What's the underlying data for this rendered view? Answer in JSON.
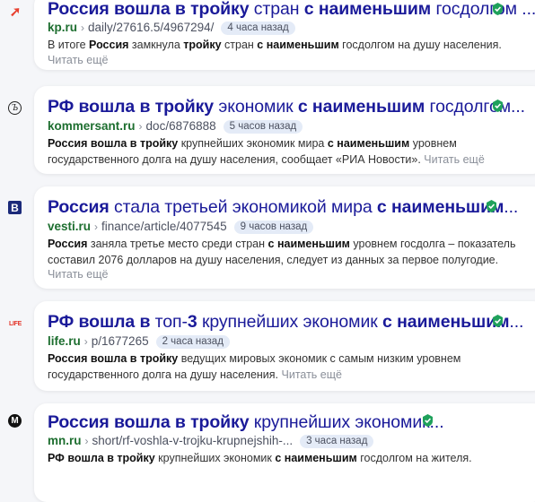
{
  "results": [
    {
      "favicon": "kp-icon",
      "title_parts": [
        [
          "Россия вошла в тройку",
          true
        ],
        [
          " стран ",
          false
        ],
        [
          "с наименьшим",
          true
        ],
        [
          " госдолгом ...",
          false
        ]
      ],
      "domain": "kp.ru",
      "path": "daily/27616.5/4967294/",
      "time": "4 часа назад",
      "snippet_lines": [
        [
          [
            "В итоге ",
            false
          ],
          [
            "Россия",
            true
          ],
          [
            " замкнула ",
            false
          ],
          [
            "тройку",
            true
          ],
          [
            " стран ",
            false
          ],
          [
            "с наименьшим",
            true
          ],
          [
            " госдолгом на душу населения.",
            false
          ]
        ]
      ],
      "more": "Читать ещё"
    },
    {
      "favicon": "kommersant-icon",
      "title_parts": [
        [
          "РФ вошла в тройку",
          true
        ],
        [
          " экономик ",
          false
        ],
        [
          "с наименьшим",
          true
        ],
        [
          " госдолгом...",
          false
        ]
      ],
      "domain": "kommersant.ru",
      "path": "doc/6876888",
      "time": "5 часов назад",
      "snippet_lines": [
        [
          [
            "Россия вошла в тройку",
            true
          ],
          [
            " крупнейших экономик мира ",
            false
          ],
          [
            "с наименьшим",
            true
          ],
          [
            " уровнем",
            false
          ]
        ],
        [
          [
            "государственного долга на душу населения, сообщает «РИА Новости».",
            false
          ]
        ]
      ],
      "more": "Читать ещё"
    },
    {
      "favicon": "vesti-icon",
      "title_parts": [
        [
          "Россия",
          true
        ],
        [
          " стала третьей экономикой мира ",
          false
        ],
        [
          "с наименьшим",
          true
        ],
        [
          "...",
          false
        ]
      ],
      "domain": "vesti.ru",
      "path": "finance/article/4077545",
      "time": "9 часов назад",
      "snippet_lines": [
        [
          [
            "Россия",
            true
          ],
          [
            " заняла третье место среди стран ",
            false
          ],
          [
            "с наименьшим",
            true
          ],
          [
            " уровнем госдолга – показатель",
            false
          ]
        ],
        [
          [
            "составил 2076 долларов на душу населения, следует из данных за первое полугодие.",
            false
          ]
        ]
      ],
      "more": "Читать ещё"
    },
    {
      "favicon": "life-icon",
      "title_parts": [
        [
          "РФ вошла в",
          true
        ],
        [
          " топ-",
          false
        ],
        [
          "3",
          true
        ],
        [
          " крупнейших экономик ",
          false
        ],
        [
          "с наименьшим",
          true
        ],
        [
          "...",
          false
        ]
      ],
      "domain": "life.ru",
      "path": "p/1677265",
      "time": "2 часа назад",
      "snippet_lines": [
        [
          [
            "Россия вошла в тройку",
            true
          ],
          [
            " ведущих мировых экономик с самым низким уровнем",
            false
          ]
        ],
        [
          [
            "государственного долга на душу населения.",
            false
          ]
        ]
      ],
      "more": "Читать ещё"
    },
    {
      "favicon": "mn-icon",
      "title_parts": [
        [
          "Россия вошла в тройку",
          true
        ],
        [
          " крупнейших экономик...",
          false
        ]
      ],
      "domain": "mn.ru",
      "path": "short/rf-voshla-v-trojku-krupnejshih-...",
      "time": "3 часа назад",
      "snippet_lines": [
        [
          [
            "РФ вошла в тройку",
            true
          ],
          [
            " крупнейших экономик ",
            false
          ],
          [
            "с наименьшим",
            true
          ],
          [
            " госдолгом на жителя.",
            false
          ]
        ]
      ],
      "more": ""
    }
  ],
  "favicon_glyphs": {
    "kp": "➚",
    "kommersant": "Ъ",
    "vesti": "В",
    "life": "LIFE",
    "mn": "М"
  },
  "colors": {
    "title": "#1a1a99",
    "domain": "#1d6e2f",
    "verified": "#1fa15b",
    "badge_bg": "#e4ebf7"
  }
}
